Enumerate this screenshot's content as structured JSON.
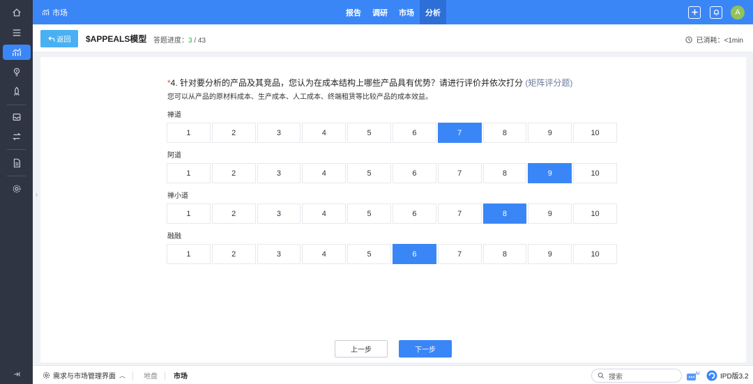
{
  "sidebar": {
    "items": [
      {
        "icon": "home-icon"
      },
      {
        "icon": "menu-icon"
      },
      {
        "icon": "analytics-icon",
        "active": true
      },
      {
        "icon": "lightbulb-icon"
      },
      {
        "icon": "rocket-icon"
      },
      {
        "icon": "inbox-icon"
      },
      {
        "icon": "transfer-icon"
      },
      {
        "icon": "document-icon"
      },
      {
        "icon": "settings-icon"
      }
    ],
    "collapse_icon": "collapse-icon"
  },
  "topbar": {
    "home_label": "市场",
    "nav": [
      {
        "label": "报告",
        "active": false
      },
      {
        "label": "调研",
        "active": false
      },
      {
        "label": "市场",
        "active": false
      },
      {
        "label": "分析",
        "active": true
      }
    ],
    "avatar_initial": "A",
    "colors": {
      "bar": "#3a86f7",
      "avatar": "#93c25a"
    }
  },
  "header": {
    "back_label": "返回",
    "title": "$APPEALS模型",
    "progress_label": "答题进度：",
    "progress_current": "3",
    "progress_total": " / 43",
    "time_label": "已消耗：<1min"
  },
  "question": {
    "required_mark": "*",
    "title": "4. 针对要分析的产品及其竞品，您认为在成本结构上哪些产品具有优势？请进行评价并依次打分",
    "type_tag": "(矩阵评分题)",
    "hint": "您可以从产品的原材料成本、生产成本、人工成本、终端租赁等比较产品的成本效益。",
    "scale": [
      "1",
      "2",
      "3",
      "4",
      "5",
      "6",
      "7",
      "8",
      "9",
      "10"
    ],
    "rows": [
      {
        "label": "禅道",
        "selected": "7"
      },
      {
        "label": "阿道",
        "selected": "9"
      },
      {
        "label": "禅小道",
        "selected": "8"
      },
      {
        "label": "融融",
        "selected": "6"
      }
    ]
  },
  "buttons": {
    "prev": "上一步",
    "next": "下一步"
  },
  "bottombar": {
    "menu_label": "需求与市场管理界面",
    "tabs": [
      {
        "label": "地盘",
        "active": false
      },
      {
        "label": "市场",
        "active": true
      }
    ],
    "search_placeholder": "搜索",
    "ai_label": "AI",
    "version": "IPD版3.2"
  }
}
